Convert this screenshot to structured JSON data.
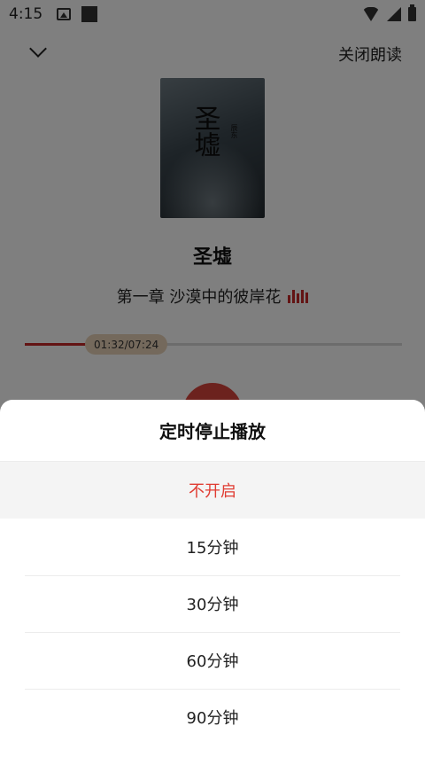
{
  "status_bar": {
    "time": "4:15",
    "icons": [
      "image-icon",
      "square-icon",
      "wifi-icon",
      "signal-icon",
      "battery-icon"
    ]
  },
  "header": {
    "close_read_label": "关闭朗读"
  },
  "book": {
    "cover_title": "圣墟",
    "cover_author": "辰东",
    "title": "圣墟",
    "chapter": "第一章 沙漠中的彼岸花"
  },
  "player": {
    "position_label": "01:32/07:24",
    "progress": 0.207,
    "accent_color": "#c62828"
  },
  "timer_sheet": {
    "title": "定时停止播放",
    "options": [
      {
        "label": "不开启",
        "selected": true
      },
      {
        "label": "15分钟",
        "selected": false
      },
      {
        "label": "30分钟",
        "selected": false
      },
      {
        "label": "60分钟",
        "selected": false
      },
      {
        "label": "90分钟",
        "selected": false
      }
    ],
    "selected_color": "#e03c32"
  }
}
